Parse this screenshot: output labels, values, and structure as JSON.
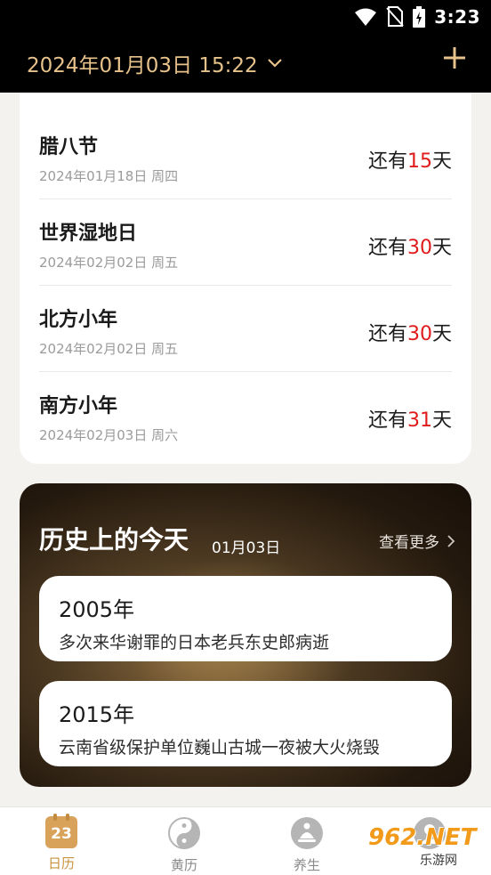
{
  "status_bar": {
    "time": "3:23"
  },
  "header": {
    "date_time": "2024年01月03日 15:22"
  },
  "festivals": [
    {
      "name": "腊八节",
      "date": "2024年01月18日 周四",
      "prefix": "还有",
      "days": "15",
      "suffix": "天"
    },
    {
      "name": "世界湿地日",
      "date": "2024年02月02日 周五",
      "prefix": "还有",
      "days": "30",
      "suffix": "天"
    },
    {
      "name": "北方小年",
      "date": "2024年02月02日 周五",
      "prefix": "还有",
      "days": "30",
      "suffix": "天"
    },
    {
      "name": "南方小年",
      "date": "2024年02月03日 周六",
      "prefix": "还有",
      "days": "31",
      "suffix": "天"
    }
  ],
  "history": {
    "title": "历史上的今天",
    "date": "01月03日",
    "more_label": "查看更多",
    "events": [
      {
        "year": "2005年",
        "description": "多次来华谢罪的日本老兵东史郎病逝"
      },
      {
        "year": "2015年",
        "description": "云南省级保护单位巍山古城一夜被大火烧毁"
      }
    ]
  },
  "bottom_nav": {
    "calendar_day": "23",
    "items": [
      {
        "label": "日历",
        "icon": "calendar-icon",
        "active": true
      },
      {
        "label": "黄历",
        "icon": "yin-yang-icon",
        "active": false
      },
      {
        "label": "养生",
        "icon": "meditation-icon",
        "active": false
      },
      {
        "label": "",
        "icon": "profile-icon",
        "active": false
      }
    ]
  },
  "watermark": {
    "text": "962.NET",
    "sub": "乐游网"
  },
  "colors": {
    "accent": "#e7c28a",
    "highlight": "#e01b1b",
    "active_tab": "#c8933e"
  }
}
